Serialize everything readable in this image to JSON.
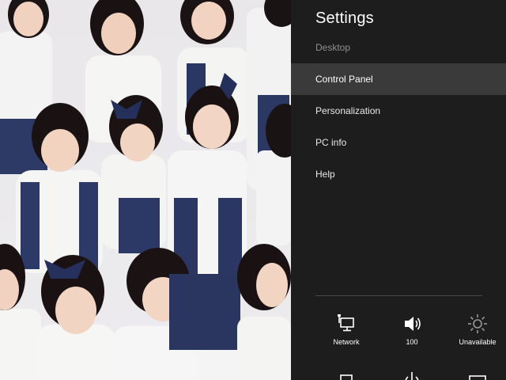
{
  "settings": {
    "title": "Settings",
    "subtitle": "Desktop",
    "menu": [
      {
        "label": "Control Panel",
        "active": true
      },
      {
        "label": "Personalization",
        "active": false
      },
      {
        "label": "PC info",
        "active": false
      },
      {
        "label": "Help",
        "active": false
      }
    ],
    "quick_settings": [
      {
        "icon": "network-icon",
        "label": "Network"
      },
      {
        "icon": "volume-icon",
        "label": "100"
      },
      {
        "icon": "brightness-icon",
        "label": "Unavailable"
      }
    ],
    "quick_settings_row2": [
      {
        "icon": "notifications-icon"
      },
      {
        "icon": "power-icon"
      },
      {
        "icon": "keyboard-icon"
      }
    ]
  },
  "colors": {
    "charm_bg": "#1d1d1d",
    "menu_active_bg": "#3a3a3a",
    "subtitle": "#8f8f8f",
    "text": "#ffffff"
  },
  "wallpaper": {
    "type": "photo",
    "subject": "group-photo"
  }
}
